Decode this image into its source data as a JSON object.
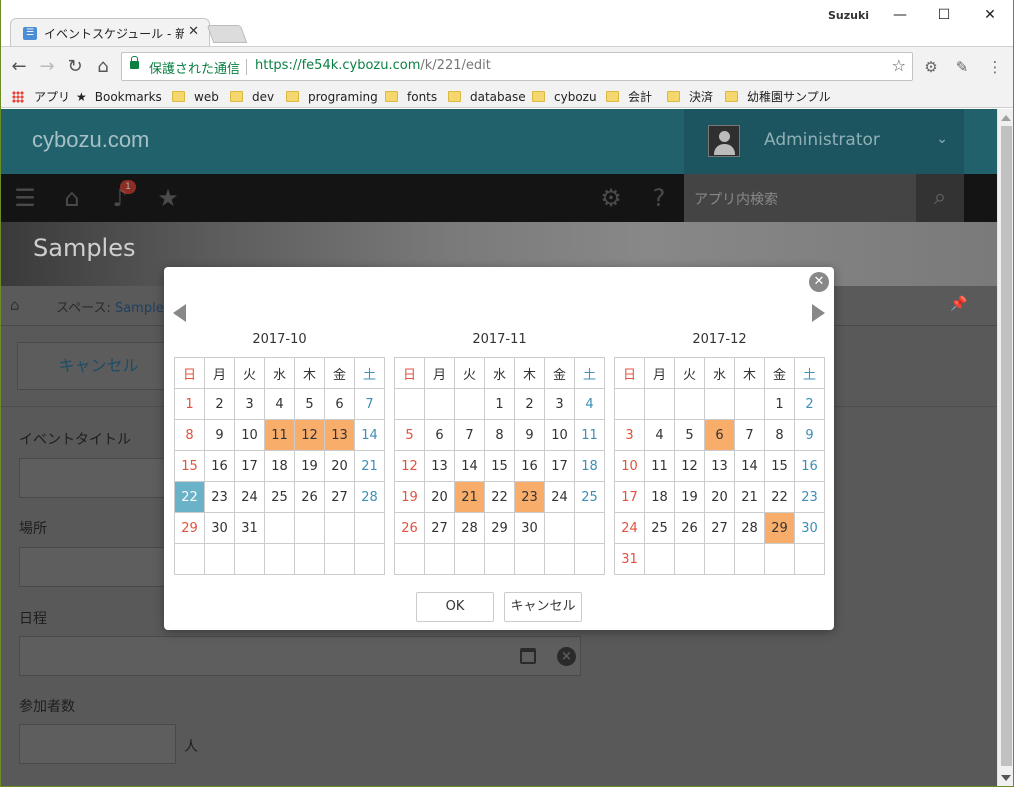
{
  "browser": {
    "tab_title": "イベントスケジュール - 新しい",
    "tab_close": "✕",
    "user": "Suzuki",
    "secure_label": "保護された通信",
    "url_host": "https://fe54k.cybozu.com",
    "url_path": "/k/221/edit",
    "bookmarks": [
      "アプリ",
      "Bookmarks",
      "web",
      "dev",
      "programing",
      "fonts",
      "database",
      "cybozu",
      "会計",
      "決済",
      "幼稚園サンプル"
    ]
  },
  "header": {
    "logo": "cybozu.com",
    "user_name": "Administrator"
  },
  "nav": {
    "notification_count": "1",
    "search_placeholder": "アプリ内検索"
  },
  "banner": {
    "title": "Samples"
  },
  "breadcrumb": {
    "prefix": "スペース: ",
    "link": "Sample"
  },
  "form": {
    "cancel_label": "キャンセル",
    "fields": [
      {
        "label": "イベントタイトル"
      },
      {
        "label": "場所"
      },
      {
        "label": "日程"
      },
      {
        "label": "参加者数",
        "unit": "人"
      }
    ]
  },
  "dialog": {
    "weekdays": [
      "日",
      "月",
      "火",
      "水",
      "木",
      "金",
      "土"
    ],
    "ok_label": "OK",
    "cancel_label": "キャンセル",
    "months": [
      {
        "title": "2017-10",
        "first_weekday": 0,
        "days": 31,
        "highlighted": [
          11,
          12,
          13
        ],
        "today": 22
      },
      {
        "title": "2017-11",
        "first_weekday": 3,
        "days": 30,
        "highlighted": [
          21,
          23
        ],
        "today": null
      },
      {
        "title": "2017-12",
        "first_weekday": 5,
        "days": 31,
        "highlighted": [
          6,
          29
        ],
        "today": null
      }
    ]
  },
  "colors": {
    "highlight": "#f9ad6b",
    "today": "#6ab2c8",
    "sunday": "#e0533d",
    "saturday": "#3d8fb6"
  }
}
